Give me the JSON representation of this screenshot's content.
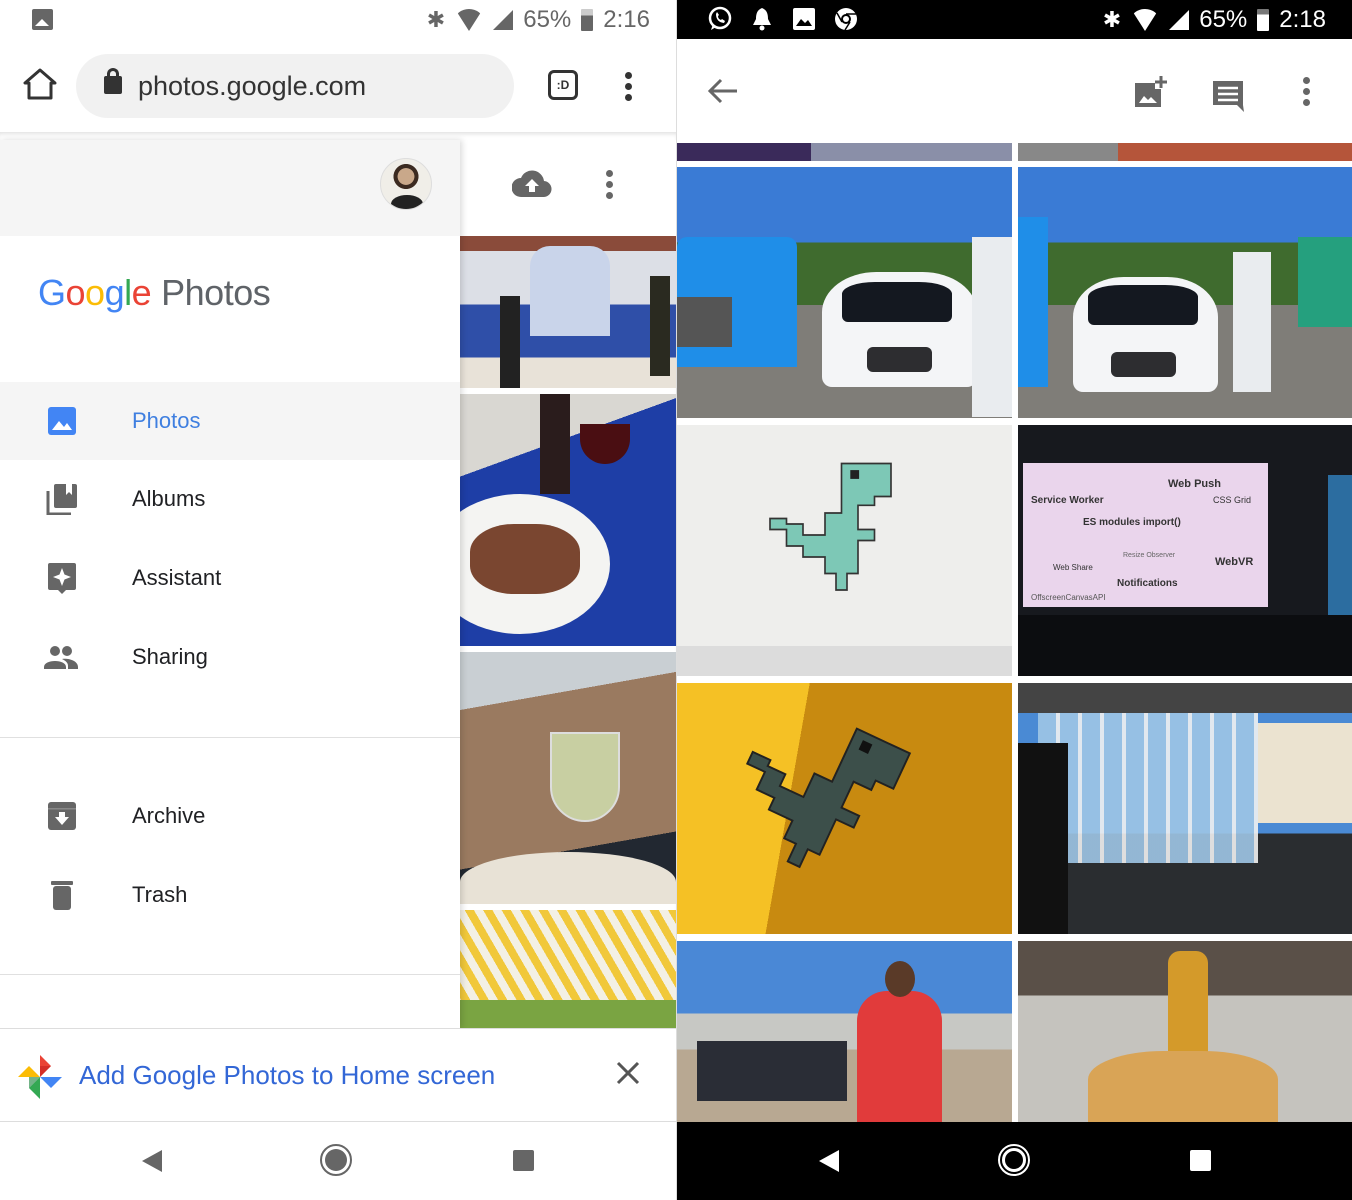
{
  "left_screen": {
    "status_bar": {
      "notification_icon": "image-icon",
      "time": "2:16",
      "battery": "65%"
    },
    "browser": {
      "url": "photos.google.com",
      "tab_switcher_label": ":D"
    },
    "app_header": {
      "upload_icon": "cloud-upload-icon"
    },
    "drawer": {
      "logo": {
        "g1": "G",
        "o1": "o",
        "o2": "o",
        "g2": "g",
        "l": "l",
        "e": "e",
        "product": "Photos"
      },
      "items": [
        {
          "label": "Photos",
          "icon": "photo-icon",
          "active": true
        },
        {
          "label": "Albums",
          "icon": "albums-icon",
          "active": false
        },
        {
          "label": "Assistant",
          "icon": "assistant-icon",
          "active": false
        },
        {
          "label": "Sharing",
          "icon": "people-icon",
          "active": false
        }
      ],
      "secondary_items": [
        {
          "label": "Archive",
          "icon": "archive-icon"
        },
        {
          "label": "Trash",
          "icon": "trash-icon"
        }
      ]
    },
    "photos": [
      {
        "desc": "dinner table with man in white shirt"
      },
      {
        "desc": "steak on plate with red wine"
      },
      {
        "desc": "glass of mojito on table"
      },
      {
        "desc": "yellow striped awning"
      }
    ],
    "add_to_home": {
      "text": "Add Google Photos to Home screen"
    }
  },
  "right_screen": {
    "status_bar": {
      "notification_icons": [
        "whatsapp-icon",
        "bell-icon",
        "image-icon",
        "chrome-icon"
      ],
      "time": "2:18",
      "battery": "65%"
    },
    "toolbar": {
      "back_icon": "arrow-back-icon",
      "add_photo_icon": "add-photo-icon",
      "comment_icon": "comment-icon",
      "more_icon": "more-vert-icon"
    },
    "photos": [
      {
        "desc": "partial photo top-left"
      },
      {
        "desc": "partial photo top-right"
      },
      {
        "desc": "Waymo truck and white car"
      },
      {
        "desc": "Waymo white car with sign"
      },
      {
        "desc": "pixel dinosaur on white wall"
      },
      {
        "desc": "conference slide word cloud",
        "slide_words": [
          "Web Push",
          "Service Worker",
          "CSS Grid",
          "ES modules import()",
          "WebVR",
          "Web Share",
          "Notifications",
          "OffscreenCanvasAPI",
          "Resize Observer"
        ]
      },
      {
        "desc": "pixel dinosaur on yellow wall"
      },
      {
        "desc": "glass building with pool"
      },
      {
        "desc": "crowd outdoors, man in red shirt"
      },
      {
        "desc": "food and beer bottle on table"
      }
    ]
  },
  "colors": {
    "accent_blue": "#3f7fe0",
    "banner_text": "#3367d6",
    "icon_gray": "#666666"
  }
}
